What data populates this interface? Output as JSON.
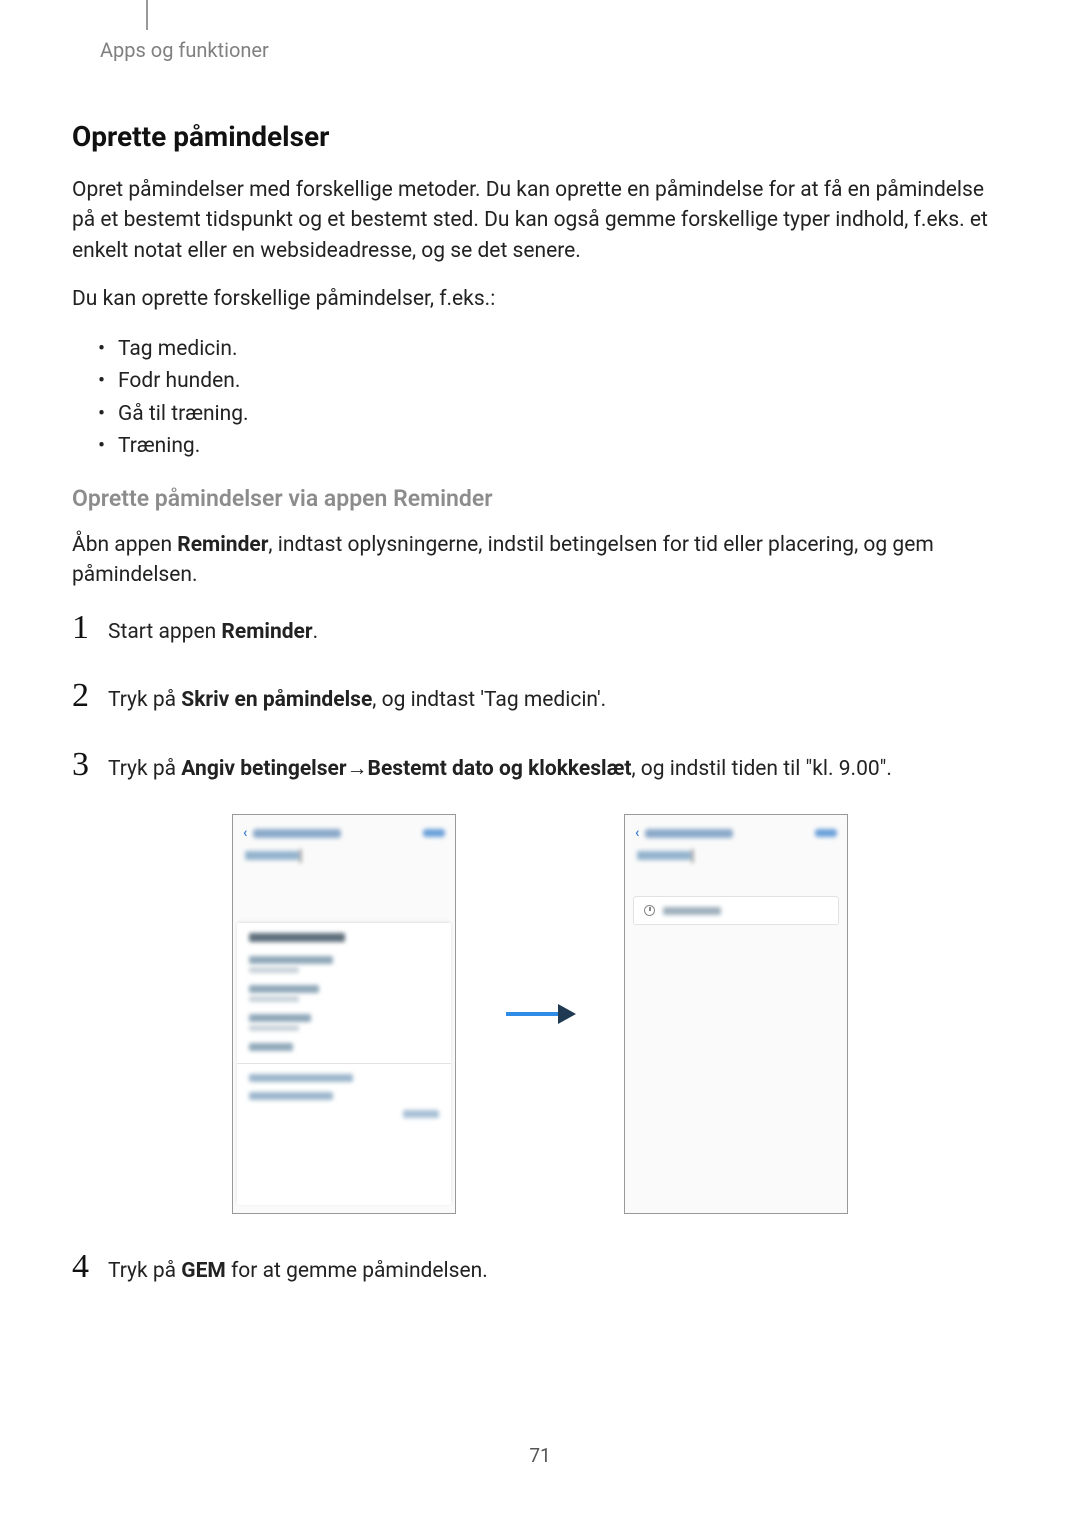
{
  "header": {
    "crumb": "Apps og funktioner"
  },
  "section": {
    "title": "Oprette påmindelser",
    "intro": "Opret påmindelser med forskellige metoder. Du kan oprette en påmindelse for at få en påmindelse på et bestemt tidspunkt og et bestemt sted. Du kan også gemme forskellige typer indhold, f.eks. et enkelt notat eller en websideadresse, og se det senere.",
    "intro2": "Du kan oprette forskellige påmindelser, f.eks.:",
    "bullets": [
      "Tag medicin.",
      "Fodr hunden.",
      "Gå til træning.",
      "Træning."
    ],
    "subtitle": "Oprette påmindelser via appen Reminder",
    "subintro_a": "Åbn appen ",
    "subintro_bold": "Reminder",
    "subintro_b": ", indtast oplysningerne, indstil betingelsen for tid eller placering, og gem påmindelsen."
  },
  "steps": {
    "s1_a": "Start appen ",
    "s1_bold": "Reminder",
    "s1_b": ".",
    "s2_a": "Tryk på ",
    "s2_bold": "Skriv en påmindelse",
    "s2_b": ", og indtast 'Tag medicin'.",
    "s3_a": "Tryk på ",
    "s3_bold1": "Angiv betingelser",
    "s3_mid": " → ",
    "s3_bold2": "Bestemt dato og klokkeslæt",
    "s3_b": ", og indstil tiden til \"kl. 9.00\".",
    "s4_a": "Tryk på ",
    "s4_bold": "GEM",
    "s4_b": " for at gemme påmindelsen."
  },
  "nums": {
    "n1": "1",
    "n2": "2",
    "n3": "3",
    "n4": "4"
  },
  "page_number": "71"
}
